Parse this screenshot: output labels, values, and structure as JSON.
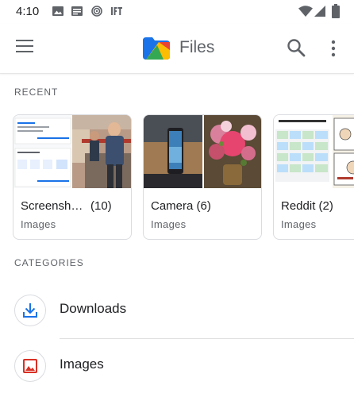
{
  "status_bar": {
    "time": "4:10"
  },
  "app_bar": {
    "title": "Files"
  },
  "sections": {
    "recent": "RECENT",
    "categories": "CATEGORIES"
  },
  "recent": [
    {
      "title": "Screensh…",
      "count": "(10)",
      "subtitle": "Images"
    },
    {
      "title": "Camera (6)",
      "subtitle": "Images"
    },
    {
      "title": "Reddit (2)",
      "subtitle": "Images"
    }
  ],
  "categories": [
    {
      "label": "Downloads",
      "icon": "download-icon"
    },
    {
      "label": "Images",
      "icon": "image-icon"
    }
  ],
  "colors": {
    "download_blue": "#1a73e8",
    "images_red": "#d93025",
    "text_secondary": "#5f6368"
  }
}
